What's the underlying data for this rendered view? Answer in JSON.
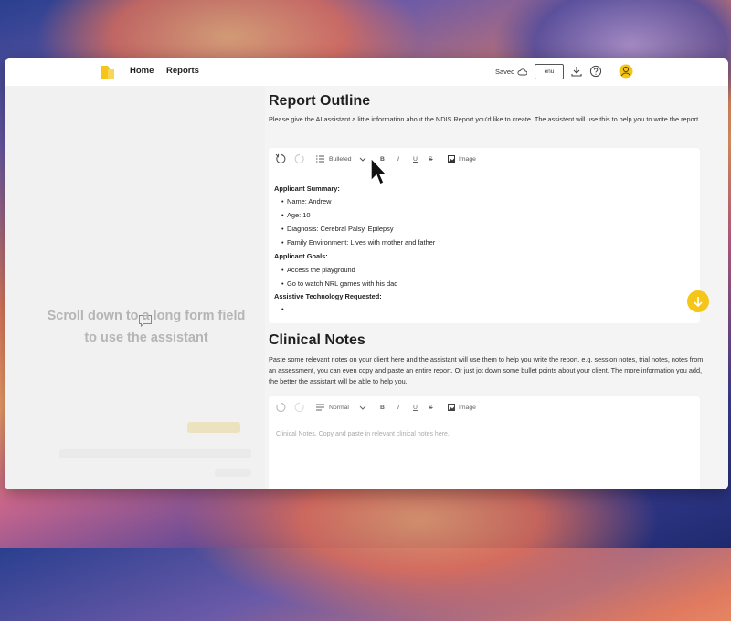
{
  "nav": {
    "home": "Home",
    "reports": "Reports"
  },
  "header": {
    "saved": "Saved",
    "language": "enu"
  },
  "left": {
    "hint": "Scroll down to a long form field to use the assistant"
  },
  "outline": {
    "title": "Report Outline",
    "description": "Please give the AI assistant a little information about the NDIS Report you'd like to create. The assistent will use this to help you to write the report.",
    "toolbar": {
      "list_style": "Bulleted",
      "bold": "B",
      "italic": "I",
      "underline": "U",
      "strike": "S",
      "image": "Image"
    },
    "summary_heading": "Applicant Summary:",
    "summary_items": [
      "Name: Andrew",
      "Age: 10",
      "Diagnosis: Cerebral Palsy, Epilepsy",
      "Family Environment: Lives with mother and father"
    ],
    "goals_heading": "Applicant Goals:",
    "goals_items": [
      "Access the playground",
      "Go to watch NRL games with his dad"
    ],
    "at_heading": "Assistive Technology Requested:"
  },
  "clinical": {
    "title": "Clinical Notes",
    "description": "Paste some relevant notes on your client here and the assistant will use them to help you write the report. e.g. session notes, trial notes, notes from an assessment, you can even copy and paste an entire report. Or just jot down some bullet points about your client. The more information you add, the better the assistant will be able to help you.",
    "toolbar": {
      "text_style": "Normal",
      "bold": "B",
      "italic": "I",
      "underline": "U",
      "strike": "S",
      "image": "Image"
    },
    "placeholder": "Clinical Notes. Copy and paste in relevant clinical notes here."
  },
  "colors": {
    "accent": "#f5c518",
    "text": "#1e1e1e"
  }
}
